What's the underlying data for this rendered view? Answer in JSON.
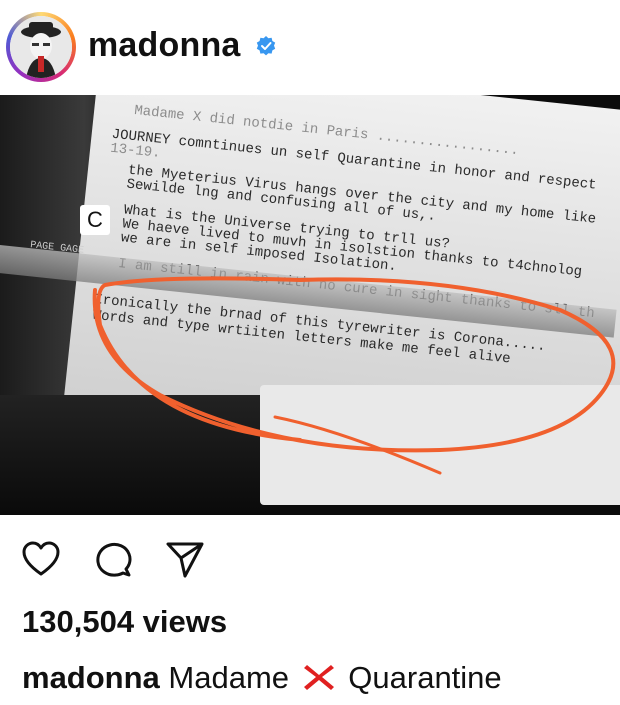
{
  "post": {
    "username": "madonna",
    "verified": true
  },
  "photo": {
    "typed_lines": [
      "Madame X did notdie in Paris .................",
      "JOURNEY comntinues un self Quarantine in honor and respect",
      "13-19.",
      "the Myeterius Virus hangs over the city and my home like",
      "Sewilde lng and confusing all of us,.",
      "What is the Universe trying to trll us?",
      "We haeve lived to muvh in isolstion thanks to t4chnolog",
      "we are in self imposed Isolation.",
      "I am still in rain with no cure in sight thanks to sll th",
      "Ironically the brnad of this tyrewriter is Corona.....",
      "Words and type wrtiiten letters make me feel alive"
    ],
    "key_label": "C",
    "scale_label": "PAGE GAGE",
    "annotation_color": "#f0602e"
  },
  "actions": {
    "like_icon": "heart-icon",
    "comment_icon": "comment-bubble-icon",
    "share_icon": "paper-plane-icon"
  },
  "views": "130,504 views",
  "caption": {
    "username": "madonna",
    "text_before": "Madame",
    "emoji": "cross-mark-emoji",
    "text_after": "Quarantine"
  }
}
